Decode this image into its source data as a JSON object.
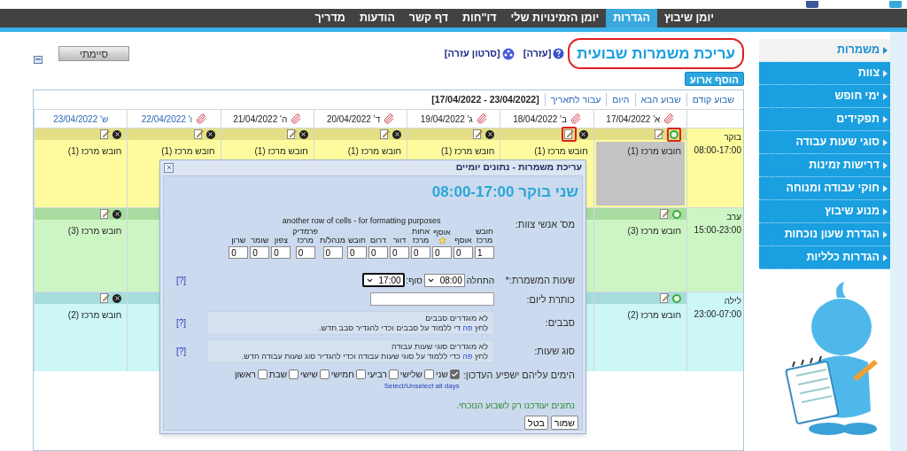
{
  "top_nav": [
    {
      "label": "יומן שיבוץ",
      "selected": false
    },
    {
      "label": "הגדרות",
      "selected": true
    },
    {
      "label": "יומן הזמינויות שלי",
      "selected": false
    },
    {
      "label": "דו\"חות",
      "selected": false
    },
    {
      "label": "דף קשר",
      "selected": false
    },
    {
      "label": "הודעות",
      "selected": false
    },
    {
      "label": "מדריך",
      "selected": false
    }
  ],
  "sidebar": {
    "items": [
      {
        "label": "משמרות",
        "selected": true
      },
      {
        "label": "צוות",
        "selected": false
      },
      {
        "label": "ימי חופש",
        "selected": false
      },
      {
        "label": "תפקידים",
        "selected": false
      },
      {
        "label": "סוגי שעות עבודה",
        "selected": false
      },
      {
        "label": "דרישות זמינות",
        "selected": false
      },
      {
        "label": "חוקי עבודה ומנוחה",
        "selected": false
      },
      {
        "label": "מנוע שיבוץ",
        "selected": false
      },
      {
        "label": "הגדרת שעון נוכחות",
        "selected": false
      },
      {
        "label": "הגדרות כלליות",
        "selected": false
      }
    ]
  },
  "page": {
    "title": "עריכת משמרות שבועית",
    "title_highlighted": true,
    "help_link": "[עזרה]",
    "video_link": "[סרטון עזרה]",
    "done_button": "סיימתי",
    "add_event_button": "הוסף ארוע"
  },
  "calendar": {
    "nav": [
      "שבוע קודם",
      "שבוע הבא",
      "היום",
      "עבור לתאריך"
    ],
    "range": "[17/04/2022 - 23/04/2022]",
    "days": [
      {
        "label": "א' 17/04/2022",
        "attachment": true,
        "link": false
      },
      {
        "label": "ב' 18/04/2022",
        "attachment": true,
        "link": false
      },
      {
        "label": "ג' 19/04/2022",
        "attachment": true,
        "link": false
      },
      {
        "label": "ד' 20/04/2022",
        "attachment": true,
        "link": false
      },
      {
        "label": "ה' 21/04/2022",
        "attachment": true,
        "link": false
      },
      {
        "label": "ו' 22/04/2022",
        "attachment": true,
        "link": true
      },
      {
        "label": "ש' 23/04/2022",
        "attachment": false,
        "link": true
      }
    ],
    "shifts": [
      {
        "name": "בוקר",
        "hours": "08:00-17:00",
        "kind": "morning",
        "cells": [
          {
            "text": "חובש מרכז (1)",
            "active": true,
            "grayed": true,
            "status_marked": true,
            "edit_marked": false
          },
          {
            "text": "חובש מרכז (1)",
            "active": false,
            "grayed": false,
            "status_marked": false,
            "edit_marked": true
          },
          {
            "text": "חובש מרכז (1)",
            "active": false,
            "grayed": false
          },
          {
            "text": "חובש מרכז (1)",
            "active": false,
            "grayed": false
          },
          {
            "text": "חובש מרכז (1)",
            "active": false,
            "grayed": false
          },
          {
            "text": "חובש מרכז (1)",
            "active": false,
            "grayed": false
          },
          {
            "text": "חובש מרכז (1)",
            "active": false,
            "grayed": false
          }
        ]
      },
      {
        "name": "ערב",
        "hours": "15:00-23:00",
        "kind": "evening",
        "cells": [
          {
            "text": "חובש מרכז (3)",
            "active": true,
            "grayed": false
          },
          {},
          {},
          {},
          {},
          {},
          {
            "text": "חובש מרכז (3)",
            "active": false,
            "grayed": false
          }
        ]
      },
      {
        "name": "לילה",
        "hours": "23:00-07:00",
        "kind": "night",
        "cells": [
          {
            "text": "חובש מרכז (2)",
            "active": true,
            "grayed": false
          },
          {},
          {},
          {},
          {},
          {},
          {
            "text": "חובש מרכז (2)",
            "active": false,
            "grayed": false
          }
        ]
      }
    ]
  },
  "dialog": {
    "title": "עריכת משמרות - נתונים יומיים",
    "heading": "שני בוקר 08:00-17:00",
    "staff": {
      "label": "מס' אנשי צוות:",
      "note": "another row of cells - for formatting purposes",
      "roles": [
        {
          "name": "חובש",
          "sub": "מרכז",
          "starred": false,
          "value": "1"
        },
        {
          "name": "אוסף",
          "starred": false,
          "value": "0"
        },
        {
          "name": "אוסף",
          "starred": true,
          "value": "0"
        },
        {
          "name": "אחות",
          "sub": "מרכז",
          "starred": false,
          "value": "0"
        },
        {
          "name": "דוור",
          "starred": false,
          "value": "0"
        },
        {
          "name": "דרום",
          "starred": false,
          "value": "0"
        },
        {
          "name": "חובש",
          "starred": false,
          "value": "0"
        },
        {
          "name": "מנהל/ת",
          "starred": false,
          "value": "0"
        },
        {
          "name": "פרמדיק",
          "sub": "מרכז",
          "starred": false,
          "value": "0"
        },
        {
          "name": "צפון",
          "starred": false,
          "value": "0"
        },
        {
          "name": "שומר",
          "starred": false,
          "value": "0"
        },
        {
          "name": "שרון",
          "starred": false,
          "value": "0"
        }
      ]
    },
    "hours": {
      "label": "שעות המשמרת:*",
      "start_label": "התחלה",
      "start": "08:00",
      "end_label": "סוף:",
      "end": "17:00",
      "help": "[?]"
    },
    "day_title": {
      "label": "כותרת ליום:"
    },
    "rotations": {
      "label": "סבבים:",
      "line1": "לא מוגדרים סבבים",
      "before": "לחץ",
      "link": "פה",
      "after": "די ללמוד על סבבים וכדי להגדיר סבב חדש.",
      "help": "[?]"
    },
    "hour_types": {
      "label": "סוג שעות:",
      "line1": "לא מוגדרים סוגי שעות עבודה",
      "before": "לחץ",
      "link": "פה",
      "after": "כדי ללמוד על סוגי שעות עבודה וכדי להגדיר סוג שעות עבודה חדש.",
      "help": "[?]"
    },
    "days": {
      "label": "הימים עליהם ישפיע העדכון:",
      "items": [
        {
          "label": "שני",
          "checked": true
        },
        {
          "label": "שלישי",
          "checked": false
        },
        {
          "label": "רביעי",
          "checked": false
        },
        {
          "label": "חמישי",
          "checked": false
        },
        {
          "label": "שישי",
          "checked": false
        },
        {
          "label": "שבת",
          "checked": false
        },
        {
          "label": "ראשון",
          "checked": false
        }
      ],
      "toggle_all": "Select/Unselect all days"
    },
    "notice": "נתונים יעודכנו רק לשבוע הנוכחי.",
    "buttons": [
      "שמור",
      "בטל"
    ]
  }
}
